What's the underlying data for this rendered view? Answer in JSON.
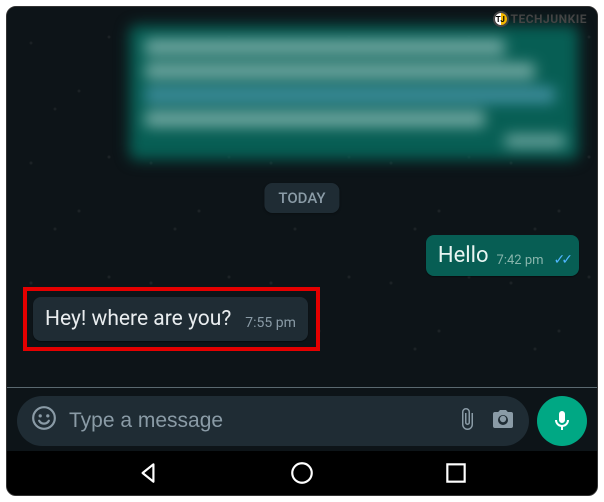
{
  "watermark": {
    "logo_text": "TJ",
    "text": "TECHJUNKIE"
  },
  "date_divider": "TODAY",
  "messages": {
    "outgoing": {
      "text": "Hello",
      "time": "7:42 pm",
      "status": "read"
    },
    "incoming": {
      "text": "Hey! where are you?",
      "time": "7:55 pm"
    }
  },
  "composer": {
    "placeholder": "Type a message",
    "emoji_icon": "emoji-icon",
    "attach_icon": "attach-icon",
    "camera_icon": "camera-icon",
    "mic_icon": "mic-icon"
  },
  "nav": {
    "back": "back-button",
    "home": "home-button",
    "recent": "recent-button"
  },
  "colors": {
    "accent": "#00a884",
    "out_bubble": "#075e54",
    "in_bubble": "#1f2c34",
    "highlight_border": "#e40000"
  }
}
